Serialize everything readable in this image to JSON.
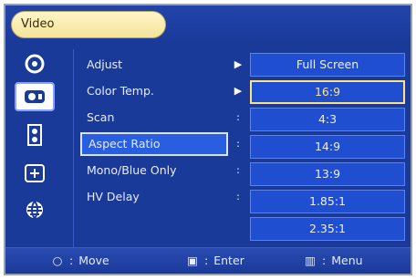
{
  "header": {
    "title": "Video"
  },
  "sidebar": {
    "icons": [
      {
        "name": "picture-icon",
        "active": false
      },
      {
        "name": "video-icon",
        "active": true
      },
      {
        "name": "audio-icon",
        "active": false
      },
      {
        "name": "setup-icon",
        "active": false
      },
      {
        "name": "globe-icon",
        "active": false
      }
    ]
  },
  "menu": {
    "items": [
      {
        "label": "Adjust",
        "mark": "▶"
      },
      {
        "label": "Color Temp.",
        "mark": "▶"
      },
      {
        "label": "Scan",
        "mark": ":"
      },
      {
        "label": "Aspect Ratio",
        "mark": ":",
        "selected": true
      },
      {
        "label": "Mono/Blue Only",
        "mark": ":"
      },
      {
        "label": "HV Delay",
        "mark": ":"
      }
    ]
  },
  "options": {
    "items": [
      {
        "label": "Full Screen"
      },
      {
        "label": "16:9",
        "current": true
      },
      {
        "label": "4:3"
      },
      {
        "label": "14:9"
      },
      {
        "label": "13:9"
      },
      {
        "label": "1.85:1"
      },
      {
        "label": "2.35:1"
      }
    ]
  },
  "footer": {
    "move_label": "Move",
    "enter_label": "Enter",
    "menu_label": "Menu",
    "move_icon": "○",
    "enter_icon": "▣",
    "menu_icon": "▥"
  }
}
